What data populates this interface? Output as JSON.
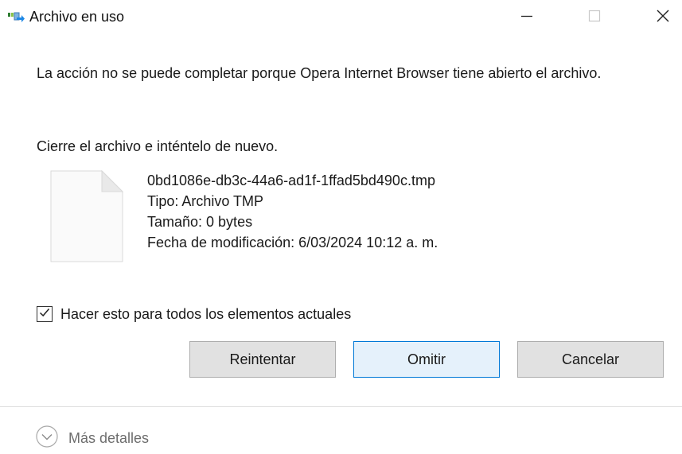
{
  "window": {
    "title": "Archivo en uso",
    "icon": "file-move-icon",
    "controls": [
      "minimize-icon",
      "maximize-icon",
      "close-icon"
    ]
  },
  "dialog": {
    "message": "La acción no se puede completar porque Opera Internet Browser tiene abierto el archivo.",
    "instruction": "Cierre el archivo e inténtelo de nuevo."
  },
  "file": {
    "icon": "document-icon",
    "name": "0bd1086e-db3c-44a6-ad1f-1ffad5bd490c.tmp",
    "type": "Tipo: Archivo TMP",
    "size": "Tamaño: 0 bytes",
    "modified": "Fecha de modificación: 6/03/2024 10:12 a. m."
  },
  "checkbox": {
    "label": "Hacer esto para todos los elementos actuales",
    "checked": true
  },
  "buttons": {
    "retry": "Reintentar",
    "skip": "Omitir",
    "cancel": "Cancelar"
  },
  "footer": {
    "details_label": "Más detalles",
    "icon": "chevron-down-circle-icon"
  },
  "colors": {
    "focus_border": "#0078d7",
    "focus_fill": "#e5f1fb",
    "button_fill": "#e1e1e1"
  }
}
